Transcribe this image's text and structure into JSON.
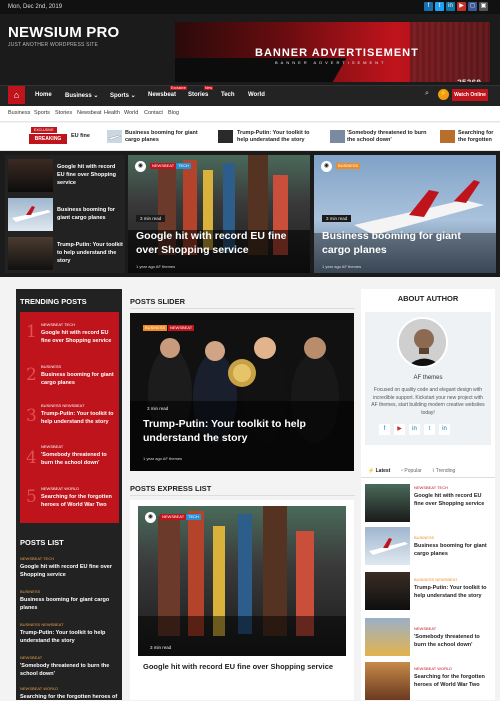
{
  "topbar": {
    "date": "Mon, Dec 2nd, 2019",
    "social": [
      "f",
      "t",
      "in",
      "▶",
      "◻",
      "▣"
    ]
  },
  "header": {
    "logo": "NEWSIUM PRO",
    "tagline": "JUST ANOTHER WORDPRESS SITE",
    "banner_title": "BANNER ADVERTISEMENT",
    "banner_sub": "BANNER ADVERTISEMENT",
    "banner_number": "25260"
  },
  "nav": {
    "home_icon": "⌂",
    "items": [
      "Home",
      "Business",
      "Sports",
      "Newsbeat",
      "Stories",
      "Tech",
      "World"
    ],
    "badge_exclusive": "Exclusive",
    "badge_new": "New",
    "search_icon": "⌕",
    "bolt_icon": "⚡",
    "watch_label": "Watch Online"
  },
  "subnav": [
    "Business",
    "Sports",
    "Stories",
    "Newsbeat",
    "Health",
    "World",
    "Contact",
    "Blog"
  ],
  "breaking": {
    "exclusive": "EXCLUSIVE",
    "label": "BREAKING NEWS",
    "items": [
      "EU fine",
      "Business booming for giant cargo planes",
      "Trump-Putin: Your toolkit to help understand the story",
      "'Somebody threatened to burn the school down'",
      "Searching for the forgotten heroes of World War Two"
    ]
  },
  "hero": {
    "list": [
      "Google hit with record EU fine over Shopping service",
      "Business booming for giant cargo planes",
      "Trump-Putin: Your toolkit to help understand the story"
    ],
    "big1": {
      "tags": [
        "NEWSBEAT",
        "TECH"
      ],
      "read": "3 min read",
      "title": "Google hit with record EU fine over Shopping service",
      "meta": "1 year ago   AF themes"
    },
    "big2": {
      "tags": [
        "BUSINESS"
      ],
      "read": "3 min read",
      "title": "Business booming for giant cargo planes",
      "meta": "1 year ago   AF themes"
    }
  },
  "trending": {
    "heading": "TRENDING POSTS",
    "items": [
      {
        "n": "1",
        "cat": "NEWSBEAT  TECH",
        "title": "Google hit with record EU fine over Shopping service"
      },
      {
        "n": "2",
        "cat": "BUSINESS",
        "title": "Business booming for giant cargo planes"
      },
      {
        "n": "3",
        "cat": "BUSINESS  NEWSBEAT",
        "title": "Trump-Putin: Your toolkit to help understand the story"
      },
      {
        "n": "4",
        "cat": "NEWSBEAT",
        "title": "'Somebody threatened to burn the school down'"
      },
      {
        "n": "5",
        "cat": "NEWSBEAT  WORLD",
        "title": "Searching for the forgotten heroes of World War Two"
      }
    ]
  },
  "posts_list": {
    "heading": "POSTS LIST",
    "items": [
      {
        "cat": "NEWSBEAT  TECH",
        "title": "Google hit with record EU fine over Shopping service"
      },
      {
        "cat": "BUSINESS",
        "title": "Business booming for giant cargo planes"
      },
      {
        "cat": "BUSINESS  NEWSBEAT",
        "title": "Trump-Putin: Your toolkit to help understand the story"
      },
      {
        "cat": "NEWSBEAT",
        "title": "'Somebody threatened to burn the school down'"
      },
      {
        "cat": "NEWSBEAT  WORLD",
        "title": "Searching for the forgotten heroes of"
      }
    ]
  },
  "slider": {
    "heading": "POSTS SLIDER",
    "tags": [
      "BUSINESS",
      "NEWSBEAT"
    ],
    "read": "3 min read",
    "title": "Trump-Putin: Your toolkit to help understand the story",
    "meta": "1 year ago   AF themes"
  },
  "express": {
    "heading": "POSTS EXPRESS LIST",
    "tags": [
      "NEWSBEAT",
      "TECH"
    ],
    "read": "3 min read",
    "title": "Google hit with record EU fine over Shopping service"
  },
  "about": {
    "heading": "ABOUT AUTHOR",
    "name": "AF themes",
    "desc": "Focused on quality code and elegant design with incredible support. Kickstart your new project with AF themes, start building modern creative websites today!",
    "social": [
      "f",
      "▶",
      "in",
      "t",
      "in"
    ]
  },
  "tabs": {
    "latest": "Latest",
    "popular": "Popular",
    "trending": "Trending"
  },
  "right_list": [
    {
      "cat": "NEWSBEAT  TECH",
      "title": "Google hit with record EU fine over Shopping service"
    },
    {
      "cat": "BUSINESS",
      "title": "Business booming for giant cargo planes"
    },
    {
      "cat": "BUSINESS  NEWSBEAT",
      "title": "Trump-Putin: Your toolkit to help understand the story"
    },
    {
      "cat": "NEWSBEAT",
      "title": "'Somebody threatened to burn the school down'"
    },
    {
      "cat": "NEWSBEAT  WORLD",
      "title": "Searching for the forgotten heroes of World War Two"
    }
  ],
  "colors": {
    "accent": "#c0141c",
    "dark": "#1b1b1b",
    "tag_orange": "#f08a24",
    "tag_blue": "#2a8fd0"
  }
}
